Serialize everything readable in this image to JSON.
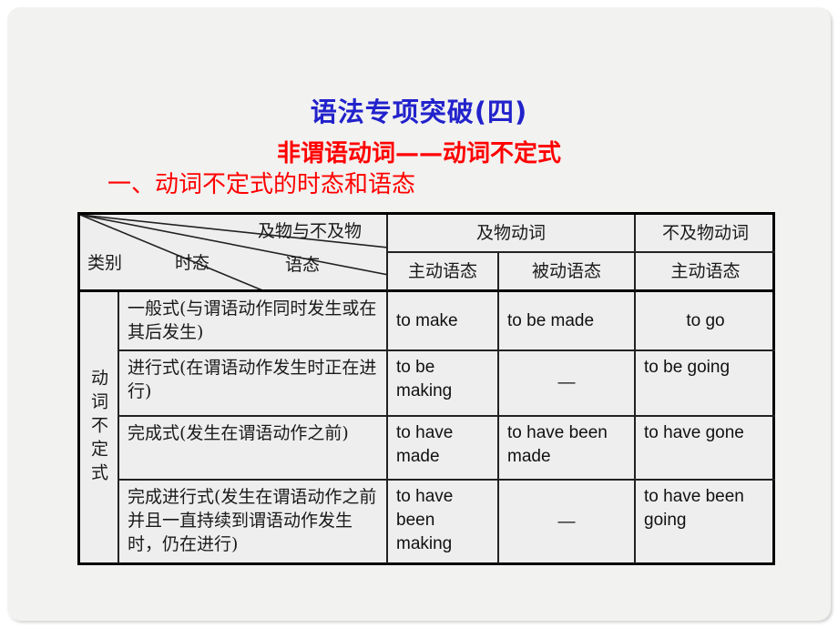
{
  "slide": {
    "title_main": "语法专项突破(四)",
    "title_sub": "非谓语动词——动词不定式",
    "title_section": "一、动词不定式的时态和语态",
    "colors": {
      "title_main": "#2222cc",
      "title_sub": "#ff0000",
      "title_section": "#ff0000",
      "table_border": "#000000",
      "background": "#f2f2f0"
    }
  },
  "table": {
    "corner": {
      "axis_top": "及物与不及物",
      "axis_left": "类别",
      "axis_mid": "时态",
      "axis_right": "语态"
    },
    "header_groups": [
      {
        "label": "及物动词",
        "span": 2
      },
      {
        "label": "不及物动词",
        "span": 1
      }
    ],
    "header_voices": [
      "主动语态",
      "被动语态",
      "主动语态"
    ],
    "row_group_label": "动词不定式",
    "rows": [
      {
        "form": "一般式(与谓语动作同时发生或在其后发生)",
        "transitive_active": "to make",
        "transitive_passive": "to be made",
        "intransitive_active": "to go"
      },
      {
        "form": "进行式(在谓语动作发生时正在进行)",
        "transitive_active": "to be making",
        "transitive_passive": "—",
        "intransitive_active": "to be going"
      },
      {
        "form": "完成式(发生在谓语动作之前)",
        "transitive_active": "to have made",
        "transitive_passive": "to have been made",
        "intransitive_active": "to have gone"
      },
      {
        "form": "完成进行式(发生在谓语动作之前并且一直持续到谓语动作发生时，仍在进行)",
        "transitive_active": "to have been making",
        "transitive_passive": "—",
        "intransitive_active": "to have been going"
      }
    ]
  }
}
